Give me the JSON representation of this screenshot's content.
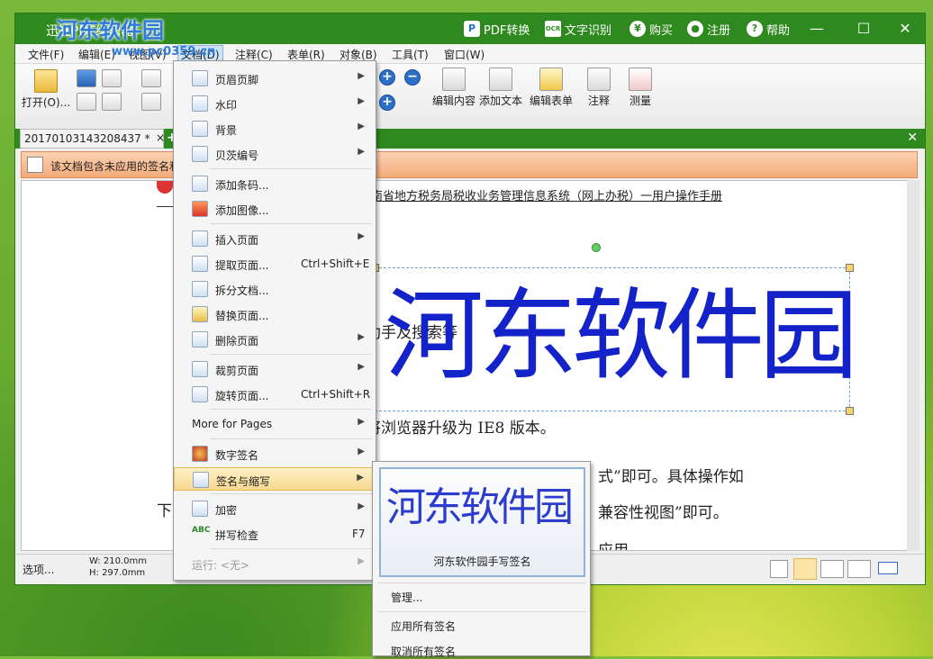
{
  "window": {
    "title": "迅捷PDF编辑器"
  },
  "watermark": {
    "brand": "河东软件园",
    "url": "www.pc0359.cn"
  },
  "titlebar": {
    "pdf_convert": "PDF转换",
    "ocr": "文字识别",
    "buy": "购买",
    "register": "注册",
    "help": "帮助",
    "ocr_icon": "OCR",
    "buy_icon": "¥",
    "help_icon": "?"
  },
  "menubar": {
    "items": [
      "文件(F)",
      "编辑(E)",
      "视图(V)",
      "文档(D)",
      "注释(C)",
      "表单(R)",
      "对象(B)",
      "工具(T)",
      "窗口(W)"
    ]
  },
  "toolbar": {
    "open": "打开(O)...",
    "edit_content": "编辑内容",
    "add_text": "添加文本",
    "edit_form": "编辑表单",
    "annotate": "注释",
    "measure": "测量"
  },
  "tab": {
    "name": "20170103143208437 *",
    "close": "×",
    "plus": "+"
  },
  "notification": {
    "text": "该文档包含未应用的签名和..."
  },
  "document": {
    "header": "南省地方税务局税收业务管理信息系统（网上办税）一用户操作手册",
    "line1": "助手及搜索等",
    "line2": "将浏览器升级为 IE8 版本。",
    "line3": "式”即可。具体操作如",
    "line4": "兼容性视图”即可。",
    "line5_left": "下",
    "line6": "应用",
    "signature": "河东软件园"
  },
  "status": {
    "options": "选项...",
    "width": "W: 210.0mm",
    "height": "H: 297.0mm"
  },
  "doc_menu": {
    "items": [
      {
        "label": "页眉页脚",
        "arrow": "▶"
      },
      {
        "label": "水印",
        "arrow": "▶"
      },
      {
        "label": "背景",
        "arrow": "▶"
      },
      {
        "label": "贝茨编号",
        "arrow": "▶"
      },
      {
        "label": "添加条码..."
      },
      {
        "label": "添加图像..."
      },
      {
        "label": "插入页面",
        "arrow": "▶"
      },
      {
        "label": "提取页面...",
        "shortcut": "Ctrl+Shift+E"
      },
      {
        "label": "拆分文档..."
      },
      {
        "label": "替换页面..."
      },
      {
        "label": "删除页面",
        "arrow": "▶"
      },
      {
        "label": "裁剪页面",
        "arrow": "▶"
      },
      {
        "label": "旋转页面...",
        "shortcut": "Ctrl+Shift+R"
      },
      {
        "label": "More for Pages",
        "arrow": "▶"
      },
      {
        "label": "数字签名",
        "arrow": "▶"
      },
      {
        "label": "签名与缩写",
        "arrow": "▶"
      },
      {
        "label": "加密",
        "arrow": "▶"
      },
      {
        "label": "拼写检查",
        "shortcut": "F7"
      },
      {
        "label": "运行: <无>",
        "arrow": "▶"
      }
    ]
  },
  "sign_submenu": {
    "signature_preview": "河东软件园",
    "signature_caption": "河东软件园手写签名",
    "manage": "管理...",
    "apply_all": "应用所有签名",
    "cancel_all": "取消所有签名"
  }
}
